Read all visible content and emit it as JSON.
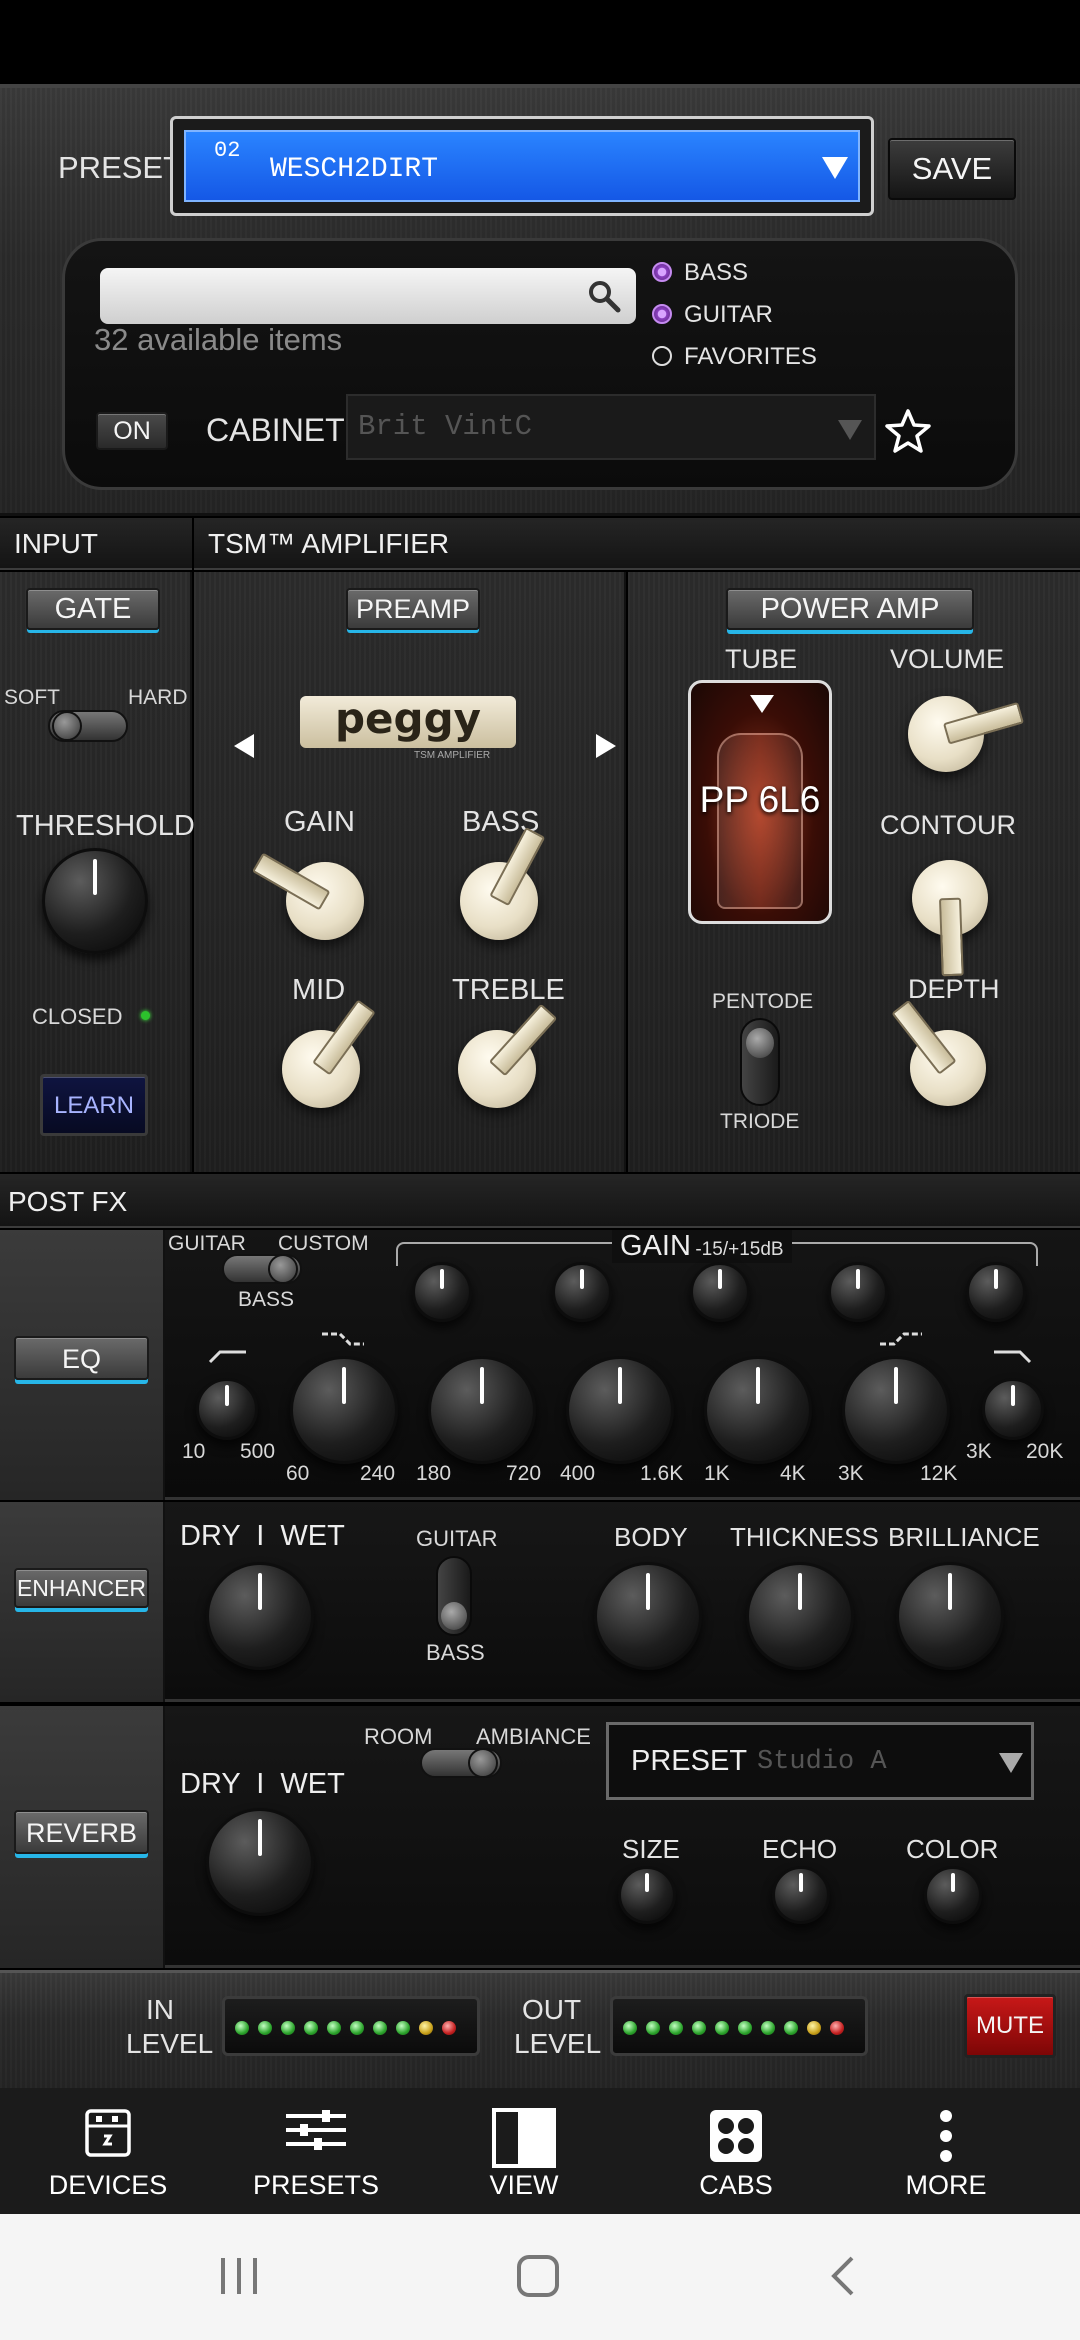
{
  "preset": {
    "label": "PRESET",
    "number": "02",
    "name": "WESCH2DIRT",
    "save": "SAVE"
  },
  "browser": {
    "search_placeholder": "",
    "available": "32 available items",
    "filters": [
      {
        "label": "BASS",
        "selected": true
      },
      {
        "label": "GUITAR",
        "selected": true
      },
      {
        "label": "FAVORITES",
        "selected": false
      }
    ],
    "on_button": "ON",
    "cabinet_label": "CABINET",
    "cabinet_value": "Brit VintC"
  },
  "sections": {
    "input": "INPUT",
    "amp": "TSM™ AMPLIFIER",
    "postfx": "POST FX"
  },
  "gate": {
    "button": "GATE",
    "soft": "SOFT",
    "hard": "HARD",
    "threshold": "THRESHOLD",
    "closed": "CLOSED",
    "learn": "LEARN"
  },
  "preamp": {
    "button": "PREAMP",
    "model": "peggy",
    "model_sub": "TSM AMPLIFIER",
    "gain": "GAIN",
    "bass": "BASS",
    "mid": "MID",
    "treble": "TREBLE"
  },
  "power": {
    "button": "POWER AMP",
    "tube": "TUBE",
    "tube_name": "PP 6L6",
    "volume": "VOLUME",
    "contour": "CONTOUR",
    "depth": "DEPTH",
    "pentode": "PENTODE",
    "triode": "TRIODE"
  },
  "eq": {
    "button": "EQ",
    "guitar": "GUITAR",
    "custom": "CUSTOM",
    "bass": "BASS",
    "gain": "GAIN",
    "gain_range": "-15/+15dB",
    "freqs": [
      [
        "10",
        "500"
      ],
      [
        "60",
        "240"
      ],
      [
        "180",
        "720"
      ],
      [
        "400",
        "1.6K"
      ],
      [
        "1K",
        "4K"
      ],
      [
        "3K",
        "12K"
      ],
      [
        "3K",
        "20K"
      ]
    ]
  },
  "enhancer": {
    "button": "ENHANCER",
    "dry": "DRY",
    "sep": "I",
    "wet": "WET",
    "guitar": "GUITAR",
    "bass": "BASS",
    "body": "BODY",
    "thickness": "THICKNESS",
    "brilliance": "BRILLIANCE"
  },
  "reverb": {
    "button": "REVERB",
    "dry": "DRY",
    "sep": "I",
    "wet": "WET",
    "room": "ROOM",
    "ambiance": "AMBIANCE",
    "preset_label": "PRESET",
    "preset_value": "Studio A",
    "size": "SIZE",
    "echo": "ECHO",
    "color": "COLOR"
  },
  "levels": {
    "in_1": "IN",
    "in_2": "LEVEL",
    "out_1": "OUT",
    "out_2": "LEVEL",
    "mute": "MUTE"
  },
  "nav": [
    {
      "label": "DEVICES",
      "icon": "devices-icon"
    },
    {
      "label": "PRESETS",
      "icon": "presets-icon"
    },
    {
      "label": "VIEW",
      "icon": "view-icon"
    },
    {
      "label": "CABS",
      "icon": "cabs-icon"
    },
    {
      "label": "MORE",
      "icon": "more-icon"
    }
  ],
  "colors": {
    "accent": "#27b6e8",
    "preset_bg": "#1a6cf0",
    "mute": "#a01010",
    "radio_on": "#9b4fd0"
  }
}
